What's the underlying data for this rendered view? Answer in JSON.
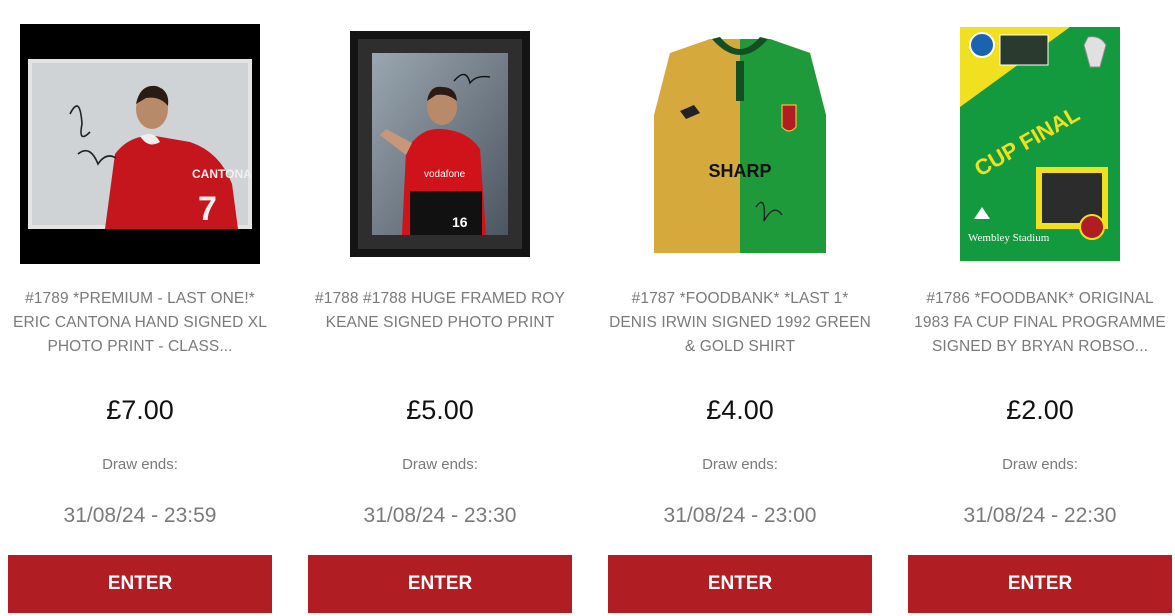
{
  "colors": {
    "accent": "#b01e23",
    "muted_text": "#7a7a7a",
    "price_text": "#111111"
  },
  "products": [
    {
      "title": "#1789 *PREMIUM - LAST ONE!* ERIC CANTONA HAND SIGNED XL PHOTO PRINT - CLASS...",
      "price": "£7.00",
      "draw_label": "Draw ends:",
      "draw_date": "31/08/24 - 23:59",
      "enter_label": "ENTER",
      "image_icon": "signed-photo-cantona"
    },
    {
      "title": "#1788 #1788 HUGE FRAMED ROY KEANE SIGNED PHOTO PRINT",
      "price": "£5.00",
      "draw_label": "Draw ends:",
      "draw_date": "31/08/24 - 23:30",
      "enter_label": "ENTER",
      "image_icon": "framed-photo-keane"
    },
    {
      "title": "#1787 *FOODBANK* *LAST 1* DENIS IRWIN SIGNED 1992 GREEN & GOLD SHIRT",
      "price": "£4.00",
      "draw_label": "Draw ends:",
      "draw_date": "31/08/24 - 23:00",
      "enter_label": "ENTER",
      "image_icon": "green-gold-shirt",
      "shirt_sponsor": "SHARP"
    },
    {
      "title": "#1786 *FOODBANK* ORIGINAL 1983 FA CUP FINAL PROGRAMME SIGNED BY BRYAN ROBSO...",
      "price": "£2.00",
      "draw_label": "Draw ends:",
      "draw_date": "31/08/24 - 22:30",
      "enter_label": "ENTER",
      "image_icon": "cup-final-programme",
      "programme_heading": "CUP FINAL",
      "programme_venue": "Wembley Stadium"
    }
  ]
}
